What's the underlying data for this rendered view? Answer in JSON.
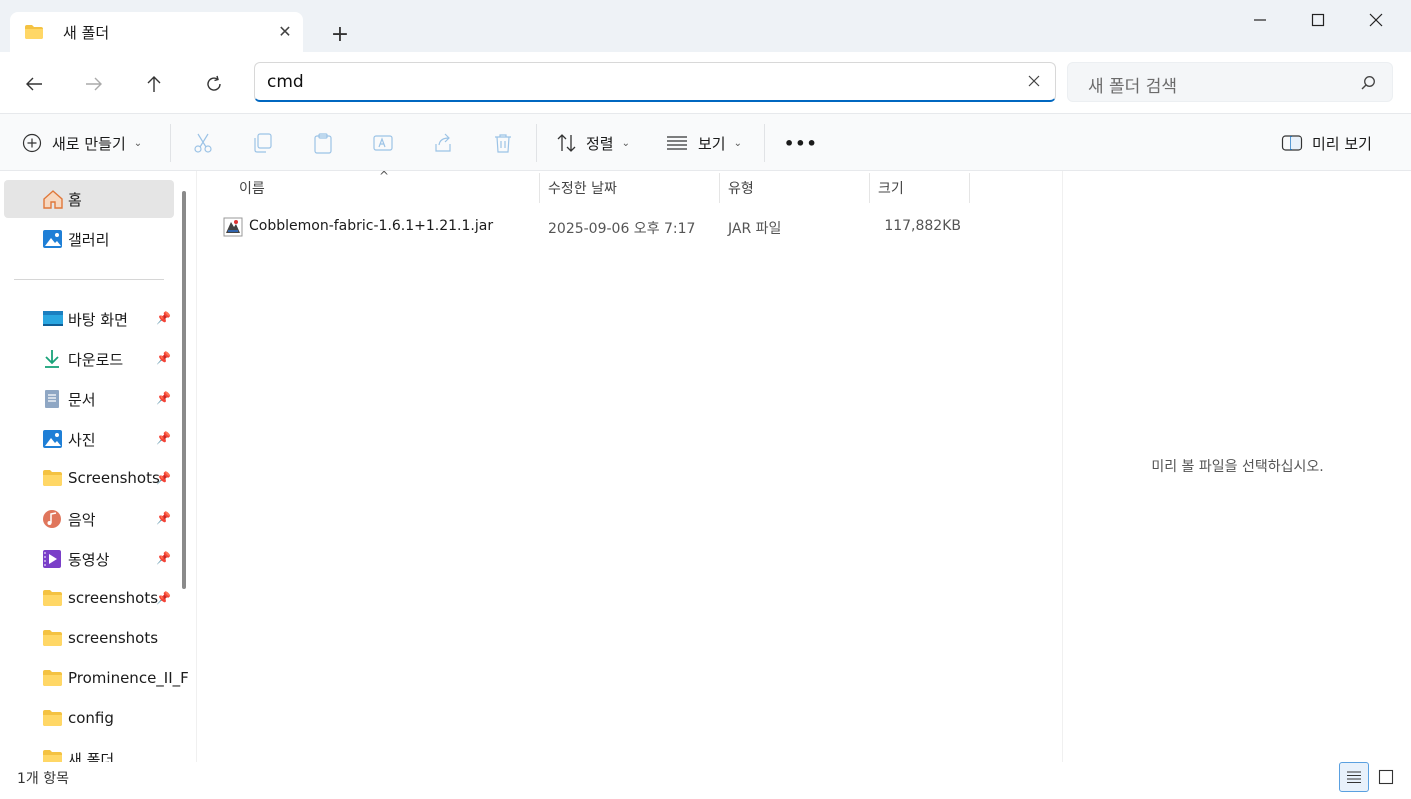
{
  "tab": {
    "title": "새 폴더",
    "close": "✕",
    "new": "+"
  },
  "address": {
    "value": "cmd"
  },
  "search": {
    "placeholder": "새 폴더 검색"
  },
  "toolbar": {
    "new_label": "새로 만들기",
    "sort_label": "정렬",
    "view_label": "보기",
    "more_label": "•••",
    "preview_label": "미리 보기"
  },
  "sidebar": {
    "home": "홈",
    "gallery": "갤러리",
    "items": [
      {
        "label": "바탕 화면",
        "icon": "desktop-icon",
        "pinned": true
      },
      {
        "label": "다운로드",
        "icon": "download-icon",
        "pinned": true
      },
      {
        "label": "문서",
        "icon": "document-icon",
        "pinned": true
      },
      {
        "label": "사진",
        "icon": "pictures-icon",
        "pinned": true
      },
      {
        "label": "Screenshots",
        "icon": "folder-icon",
        "pinned": true
      },
      {
        "label": "음악",
        "icon": "music-icon",
        "pinned": true
      },
      {
        "label": "동영상",
        "icon": "video-icon",
        "pinned": true
      },
      {
        "label": "screenshots",
        "icon": "folder-icon",
        "pinned": true
      },
      {
        "label": "screenshots",
        "icon": "folder-icon",
        "pinned": false
      },
      {
        "label": "Prominence_II_F",
        "icon": "folder-icon",
        "pinned": false
      },
      {
        "label": "config",
        "icon": "folder-icon",
        "pinned": false
      },
      {
        "label": "새 폴더",
        "icon": "folder-icon",
        "pinned": false
      }
    ]
  },
  "columns": {
    "name": "이름",
    "modified": "수정한 날짜",
    "type": "유형",
    "size": "크기"
  },
  "files": [
    {
      "name": "Cobblemon-fabric-1.6.1+1.21.1.jar",
      "modified": "2025-09-06 오후 7:17",
      "type": "JAR 파일",
      "size": "117,882KB"
    }
  ],
  "preview": {
    "empty_text": "미리 볼 파일을 선택하십시오."
  },
  "status": {
    "count": "1개 항목"
  },
  "colors": {
    "accent": "#0067c0",
    "folder": "#f4c242",
    "selection": "#e5e5e5"
  }
}
